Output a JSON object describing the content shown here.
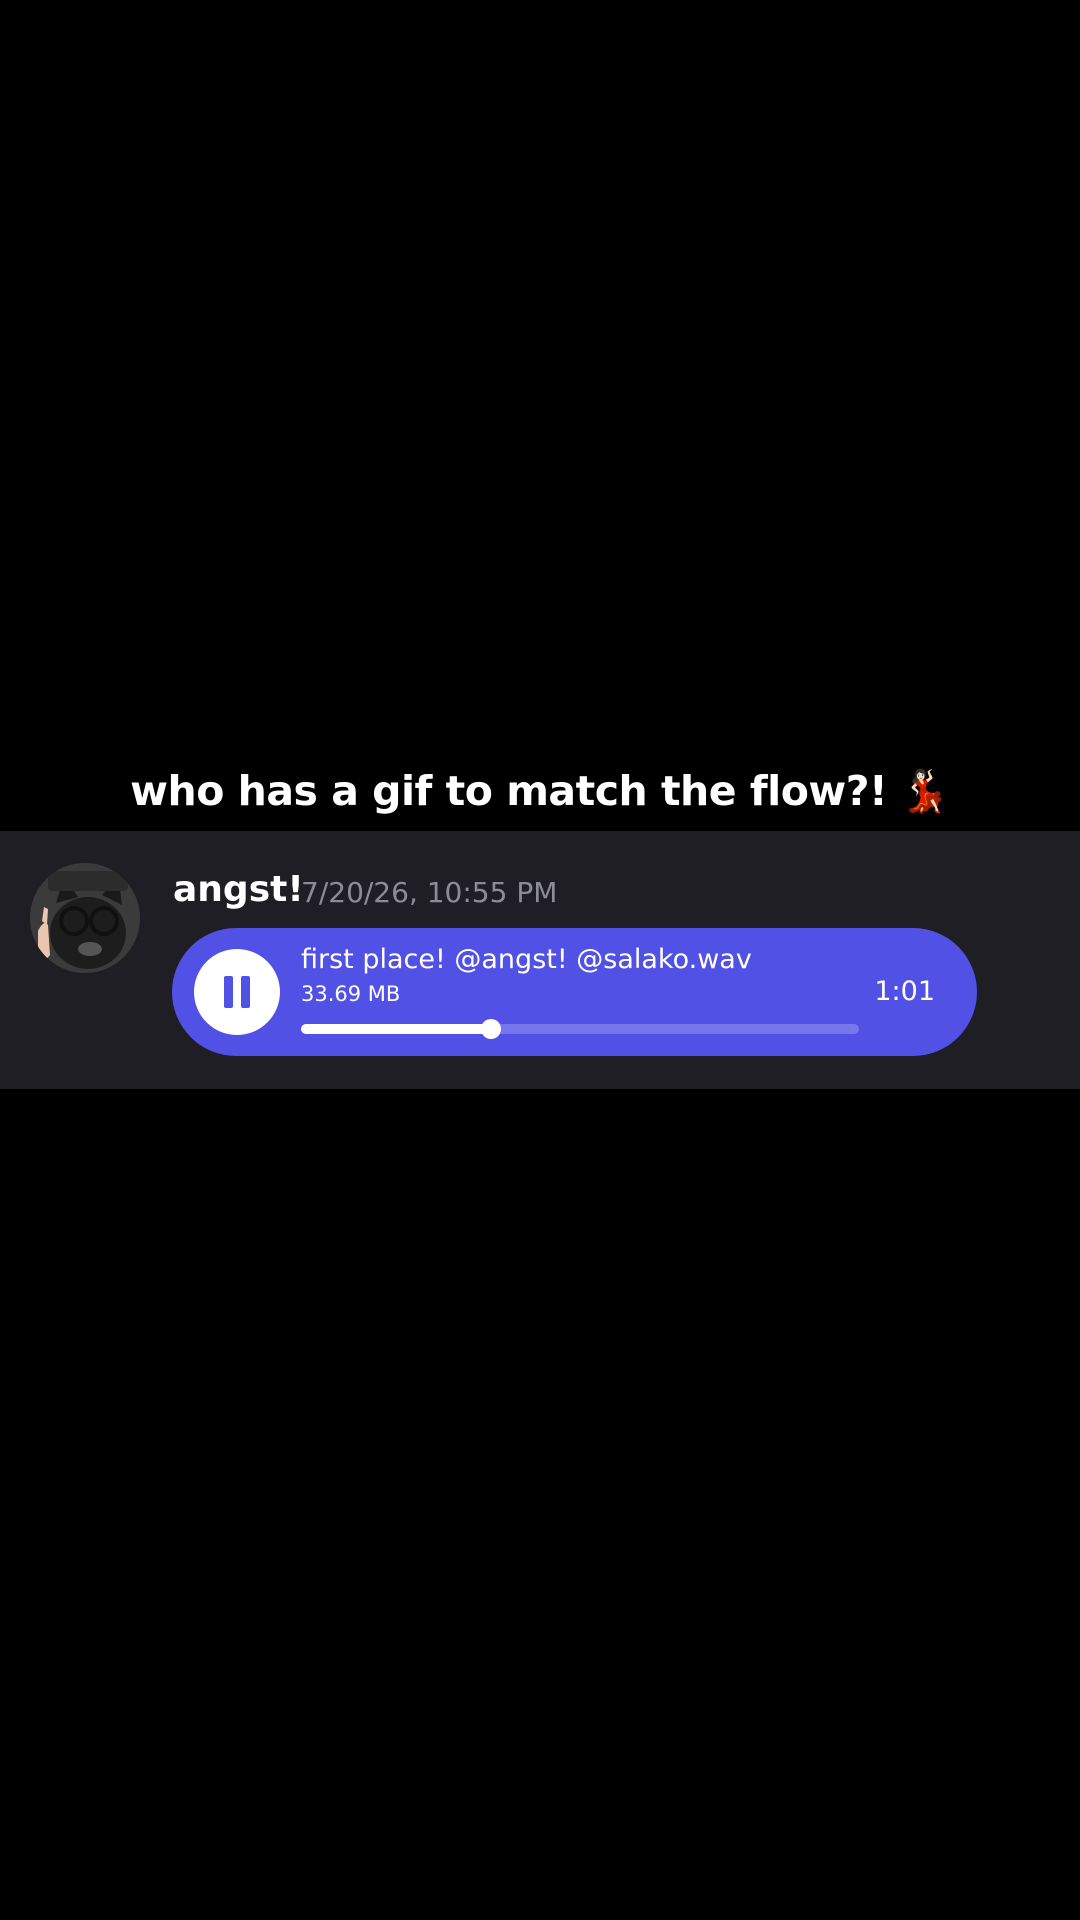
{
  "caption": {
    "text": "who has a gif to match the flow?!",
    "emoji": "💃🏻"
  },
  "message": {
    "username": "angst!",
    "timestamp": "7/20/26, 10:55 PM",
    "avatar_icon": "cat-with-glasses-avatar"
  },
  "audio": {
    "file_name": "first place! @angst! @salako.wav",
    "file_size": "33.69 MB",
    "duration": "1:01",
    "state": "playing",
    "progress": 0.34
  },
  "colors": {
    "background": "#000000",
    "message_row": "#1e1e24",
    "accent": "#5151e6",
    "timestamp": "#8c8c96",
    "text": "#ffffff"
  }
}
